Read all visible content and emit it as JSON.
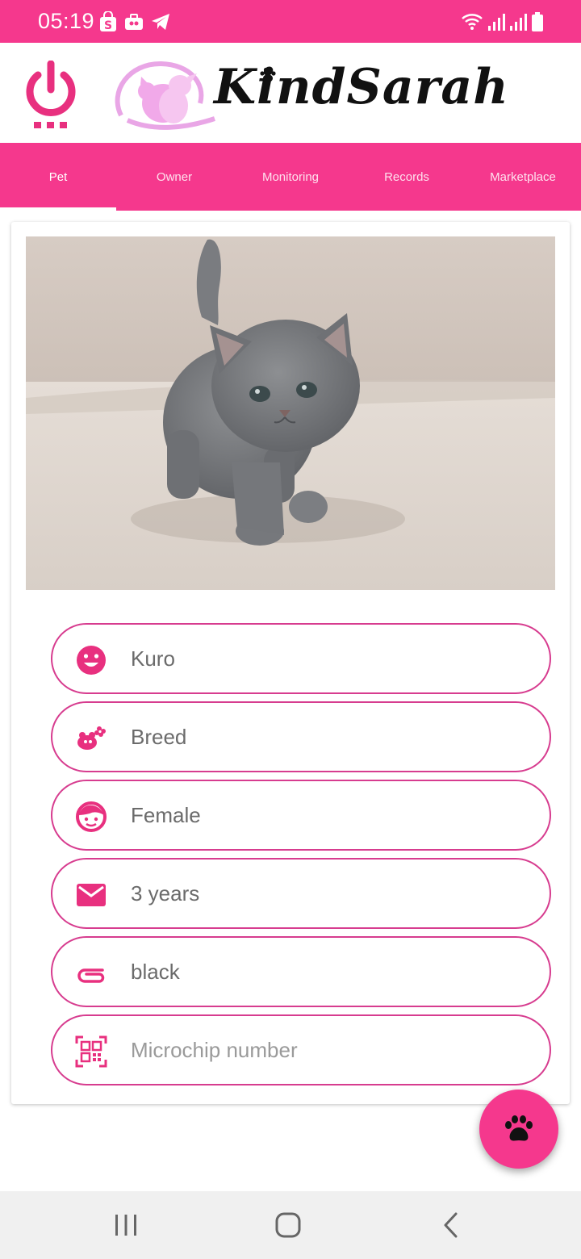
{
  "status_bar": {
    "time": "05:19",
    "left_icons": [
      "shop-bag-icon",
      "toolbox-icon",
      "telegram-icon"
    ],
    "right_icons": [
      "wifi-icon",
      "signal-icon",
      "signal-icon",
      "battery-icon"
    ]
  },
  "header": {
    "app_name": "KindSarah"
  },
  "tabs": [
    {
      "label": "Pet",
      "active": true
    },
    {
      "label": "Owner",
      "active": false
    },
    {
      "label": "Monitoring",
      "active": false
    },
    {
      "label": "Records",
      "active": false
    },
    {
      "label": "Marketplace",
      "active": false
    }
  ],
  "pet_form": {
    "fields": [
      {
        "icon": "smiley-face-icon",
        "value": "Kuro",
        "placeholder": ""
      },
      {
        "icon": "pet-bone-flower-icon",
        "value": "Breed",
        "placeholder": ""
      },
      {
        "icon": "child-face-icon",
        "value": "Female",
        "placeholder": ""
      },
      {
        "icon": "envelope-icon",
        "value": "3 years",
        "placeholder": ""
      },
      {
        "icon": "paperclip-icon",
        "value": "black",
        "placeholder": ""
      },
      {
        "icon": "qr-code-icon",
        "value": "",
        "placeholder": "Microchip number"
      }
    ]
  },
  "fab": {
    "icon": "paw-icon"
  },
  "colors": {
    "accent": "#f5388d",
    "field_border": "#d73c8f",
    "icon": "#e8307f"
  }
}
